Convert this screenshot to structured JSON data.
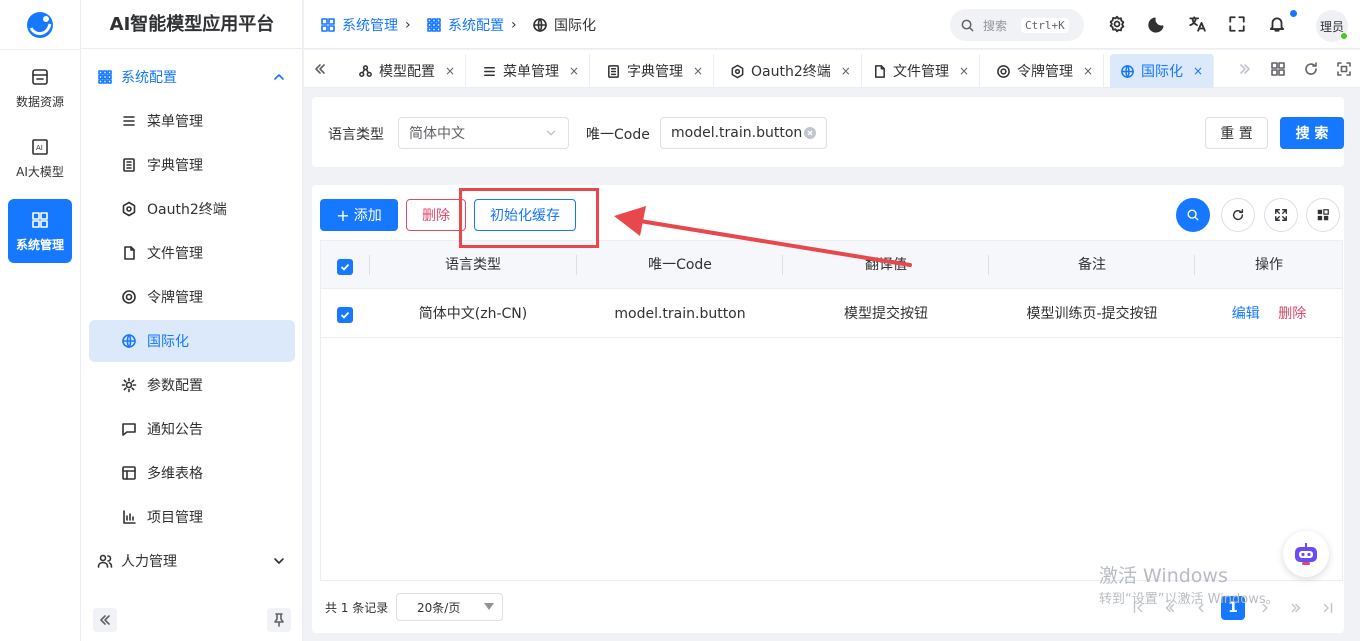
{
  "app": {
    "title": "AI智能模型应用平台"
  },
  "rail": [
    {
      "label": "数据资源",
      "icon": "database-icon"
    },
    {
      "label": "AI大模型",
      "icon": "ai-icon"
    },
    {
      "label": "系统管理",
      "icon": "system-icon",
      "active": true
    }
  ],
  "menu": {
    "group_open": "系统配置",
    "items": [
      {
        "label": "菜单管理",
        "icon": "list-icon"
      },
      {
        "label": "字典管理",
        "icon": "book-icon"
      },
      {
        "label": "Oauth2终端",
        "icon": "hexagon-icon"
      },
      {
        "label": "文件管理",
        "icon": "file-icon"
      },
      {
        "label": "令牌管理",
        "icon": "token-icon"
      },
      {
        "label": "国际化",
        "icon": "globe-icon",
        "active": true
      },
      {
        "label": "参数配置",
        "icon": "settings-icon"
      },
      {
        "label": "通知公告",
        "icon": "message-icon"
      },
      {
        "label": "多维表格",
        "icon": "table-icon"
      },
      {
        "label": "项目管理",
        "icon": "chart-icon"
      }
    ],
    "group_closed": "人力管理"
  },
  "breadcrumb": [
    "系统管理",
    "系统配置",
    "国际化"
  ],
  "header": {
    "search_label": "搜索",
    "search_shortcut": "Ctrl+K",
    "avatar_text": "理员"
  },
  "tabs": [
    {
      "label": "模型配置",
      "icon": "model-icon"
    },
    {
      "label": "菜单管理",
      "icon": "list-icon"
    },
    {
      "label": "字典管理",
      "icon": "book-icon"
    },
    {
      "label": "Oauth2终端",
      "icon": "hexagon-icon"
    },
    {
      "label": "文件管理",
      "icon": "file-icon"
    },
    {
      "label": "令牌管理",
      "icon": "token-icon"
    },
    {
      "label": "国际化",
      "icon": "globe-icon",
      "active": true
    }
  ],
  "tab_close": "×",
  "search_form": {
    "lang_label": "语言类型",
    "lang_value": "简体中文",
    "code_label": "唯一Code",
    "code_value": "model.train.button",
    "reset": "重 置",
    "search": "搜 索"
  },
  "toolbar": {
    "add": "添加",
    "delete": "删除",
    "init_cache": "初始化缓存"
  },
  "table": {
    "columns": [
      "语言类型",
      "唯一Code",
      "翻译值",
      "备注",
      "操作"
    ],
    "rows": [
      {
        "lang": "简体中文(zh-CN)",
        "code": "model.train.button",
        "value": "模型提交按钮",
        "remark": "模型训练页-提交按钮",
        "edit": "编辑",
        "delete": "删除"
      }
    ]
  },
  "pagination": {
    "total": "共 1 条记录",
    "page_size": "20条/页",
    "current": "1"
  },
  "watermark": {
    "line1": "激活 Windows",
    "line2": "转到“设置”以激活 Windows。"
  },
  "colors": {
    "primary": "#1677ff",
    "danger": "#e0496a",
    "annotation": "#e8474b"
  }
}
